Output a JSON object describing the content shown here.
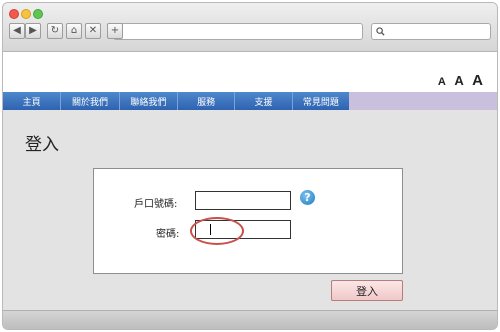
{
  "browser": {
    "url": "",
    "search_placeholder": "",
    "buttons": [
      "◀",
      "▶",
      "↻",
      "⌂",
      "✕",
      "+"
    ]
  },
  "header": {
    "font_size_controls": [
      "A",
      "A",
      "A"
    ]
  },
  "nav": {
    "items": [
      "主頁",
      "關於我們",
      "聯絡我們",
      "服務",
      "支援",
      "常見問題"
    ]
  },
  "page": {
    "title": "登入"
  },
  "form": {
    "account_label": "戶口號碼:",
    "password_label": "密碼:",
    "account_value": "",
    "password_value": "",
    "help_icon_glyph": "?",
    "submit_label": "登入"
  },
  "colors": {
    "nav_blue": "#2f63b0",
    "nav_tail": "#c8c0dc",
    "highlight": "#c9504a",
    "button_bg": "#f1c8c8"
  }
}
